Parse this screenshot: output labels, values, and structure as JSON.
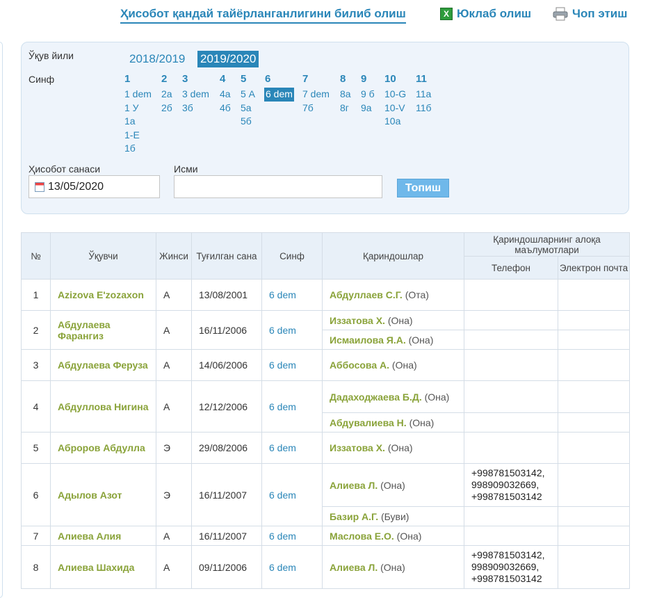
{
  "header": {
    "help_link": "Ҳисобот қандай тайёрланганлигини билиб олиш",
    "download_label": "Юклаб олиш",
    "print_label": "Чоп этиш"
  },
  "filters": {
    "year_label": "Ўқув йили",
    "years": [
      "2018/2019",
      "2019/2020"
    ],
    "selected_year": "2019/2020",
    "grade_label": "Синф",
    "grades": [
      {
        "num": "1",
        "classes": [
          "1 dem",
          "1 У",
          "1а",
          "1-Е",
          "1б"
        ]
      },
      {
        "num": "2",
        "classes": [
          "2а",
          "2б"
        ]
      },
      {
        "num": "3",
        "classes": [
          "3 dem",
          "3б"
        ]
      },
      {
        "num": "4",
        "classes": [
          "4а",
          "4б"
        ]
      },
      {
        "num": "5",
        "classes": [
          "5 А",
          "5а",
          "5б"
        ]
      },
      {
        "num": "6",
        "classes": [
          "6 dem"
        ]
      },
      {
        "num": "7",
        "classes": [
          "7 dem",
          "7б"
        ]
      },
      {
        "num": "8",
        "classes": [
          "8а",
          "8г"
        ]
      },
      {
        "num": "9",
        "classes": [
          "9 б",
          "9а"
        ]
      },
      {
        "num": "10",
        "classes": [
          "10-G",
          "10-V",
          "10а"
        ]
      },
      {
        "num": "11",
        "classes": [
          "11а",
          "11б"
        ]
      }
    ],
    "selected_class": "6 dem",
    "report_date_label": "Ҳисобот санаси",
    "report_date_value": "13/05/2020",
    "name_label": "Исми",
    "name_value": "",
    "search_button": "Топиш"
  },
  "table": {
    "headers": {
      "num": "№",
      "student": "Ўқувчи",
      "gender": "Жинси",
      "birth": "Туғилган сана",
      "class": "Синф",
      "relatives": "Қариндошлар",
      "contacts": "Қариндошларнинг алоқа маълумотлари",
      "phone": "Телефон",
      "email": "Электрон почта"
    },
    "rows": [
      {
        "num": "1",
        "student": "Azizova E'zozaxon",
        "gender": "А",
        "birth": "13/08/2001",
        "class": "6 dem",
        "relatives": [
          {
            "name": "Абдуллаев С.Г.",
            "type": "(Ота)",
            "phone": "",
            "email": ""
          }
        ]
      },
      {
        "num": "2",
        "student": "Абдулаева Фарангиз",
        "gender": "А",
        "birth": "16/11/2006",
        "class": "6 dem",
        "relatives": [
          {
            "name": "Иззатова Х.",
            "type": "(Она)",
            "phone": "",
            "email": ""
          },
          {
            "name": "Исмаилова Я.А.",
            "type": "(Она)",
            "phone": "",
            "email": ""
          }
        ]
      },
      {
        "num": "3",
        "student": "Абдулаева Феруза",
        "gender": "А",
        "birth": "14/06/2006",
        "class": "6 dem",
        "relatives": [
          {
            "name": "Аббосова А.",
            "type": "(Она)",
            "phone": "",
            "email": ""
          }
        ]
      },
      {
        "num": "4",
        "student": "Абдуллова Нигина",
        "gender": "А",
        "birth": "12/12/2006",
        "class": "6 dem",
        "relatives": [
          {
            "name": "Дадаходжаева Б.Д.",
            "type": "(Она)",
            "phone": "",
            "email": ""
          },
          {
            "name": "Абдувалиева Н.",
            "type": "(Она)",
            "phone": "",
            "email": ""
          }
        ]
      },
      {
        "num": "5",
        "student": "Аброров Абдулла",
        "gender": "Э",
        "birth": "29/08/2006",
        "class": "6 dem",
        "relatives": [
          {
            "name": "Иззатова Х.",
            "type": "(Она)",
            "phone": "",
            "email": ""
          }
        ]
      },
      {
        "num": "6",
        "student": "Адылов Азот",
        "gender": "Э",
        "birth": "16/11/2007",
        "class": "6 dem",
        "relatives": [
          {
            "name": "Алиева Л.",
            "type": "(Она)",
            "phone": "+998781503142, 998909032669, +998781503142",
            "email": ""
          },
          {
            "name": "Базир А.Г.",
            "type": "(Буви)",
            "phone": "",
            "email": ""
          }
        ]
      },
      {
        "num": "7",
        "student": "Алиева Алия",
        "gender": "А",
        "birth": "16/11/2007",
        "class": "6 dem",
        "relatives": [
          {
            "name": "Маслова Е.О.",
            "type": "(Она)",
            "phone": "",
            "email": ""
          }
        ]
      },
      {
        "num": "8",
        "student": "Алиева Шахида",
        "gender": "А",
        "birth": "09/11/2006",
        "class": "6 dem",
        "relatives": [
          {
            "name": "Алиева Л.",
            "type": "(Она)",
            "phone": "+998781503142, 998909032669, +998781503142",
            "email": ""
          }
        ]
      }
    ]
  }
}
